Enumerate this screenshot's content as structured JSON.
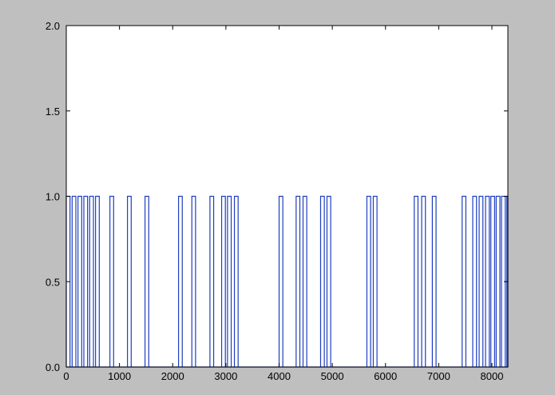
{
  "chart_data": {
    "type": "line",
    "title": "",
    "xlabel": "",
    "ylabel": "",
    "xlim": [
      0,
      8300
    ],
    "ylim": [
      0.0,
      2.0
    ],
    "grid": false,
    "xticks": [
      0,
      1000,
      2000,
      3000,
      4000,
      5000,
      6000,
      7000,
      8000
    ],
    "xtick_labels": [
      "0",
      "1000",
      "2000",
      "3000",
      "4000",
      "5000",
      "6000",
      "7000",
      "8000"
    ],
    "yticks": [
      0.0,
      0.5,
      1.0,
      1.5,
      2.0
    ],
    "ytick_labels": [
      "0.0",
      "0.5",
      "1.0",
      "1.5",
      "2.0"
    ],
    "colors": {
      "line": "#1f3fbf",
      "figure_bg": "#bfbfbf",
      "axes_bg": "#ffffff"
    },
    "series": [
      {
        "style": "step-pulses",
        "pulse_width": 70,
        "pulse_height": 1.0,
        "baseline": 0.0,
        "pulse_starts": [
          0,
          110,
          220,
          330,
          440,
          550,
          820,
          1150,
          1480,
          2110,
          2360,
          2700,
          2920,
          3030,
          3160,
          4000,
          4320,
          4450,
          4780,
          4900,
          5650,
          5770,
          6540,
          6680,
          6880,
          7440,
          7640,
          7760,
          7880,
          7980,
          8080,
          8180,
          8280
        ]
      }
    ]
  }
}
